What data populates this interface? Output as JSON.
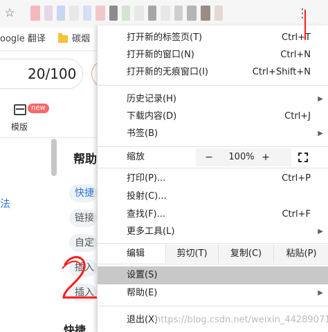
{
  "bookmarks": {
    "google_translate": "oogle 翻译",
    "folder_label": "碳烟"
  },
  "page": {
    "score": "20/100",
    "new_badge": "new",
    "template_label": "模版",
    "left_link": "法",
    "help_heading": "帮助",
    "tags": [
      "快捷",
      "链接",
      "自定",
      "插入",
      "插入"
    ],
    "bottom_heading": "快捷",
    "annotation": "2"
  },
  "menu": {
    "group1": [
      {
        "label": "打开新的标签页(T)",
        "shortcut": "Ctrl+T"
      },
      {
        "label": "打开新的窗口(N)",
        "shortcut": "Ctrl+N"
      },
      {
        "label": "打开新的无痕窗口(I)",
        "shortcut": "Ctrl+Shift+N"
      }
    ],
    "group2": [
      {
        "label": "历史记录(H)",
        "shortcut": "",
        "arrow": "▶"
      },
      {
        "label": "下载内容(D)",
        "shortcut": "Ctrl+J"
      },
      {
        "label": "书签(B)",
        "shortcut": "",
        "arrow": "▶"
      }
    ],
    "zoom": {
      "label": "缩放",
      "minus": "−",
      "value": "100%",
      "plus": "+"
    },
    "group3": [
      {
        "label": "打印(P)...",
        "shortcut": "Ctrl+P"
      },
      {
        "label": "投射(C)..."
      },
      {
        "label": "查找(F)...",
        "shortcut": "Ctrl+F"
      },
      {
        "label": "更多工具(L)",
        "arrow": "▶"
      }
    ],
    "edit": {
      "label": "编辑",
      "cut": "剪切(T)",
      "copy": "复制(C)",
      "paste": "粘贴(P)"
    },
    "group4": [
      {
        "label": "设置(S)"
      },
      {
        "label": "帮助(E)",
        "arrow": "▶"
      }
    ],
    "exit": {
      "label": "退出(X)"
    }
  },
  "watermark": "https://blog.csdn.net/weixin_44289071",
  "colors": {
    "highlight": "#c8c8c8",
    "annotation_red": "#ff1a1a",
    "link_blue": "#2f7ad6",
    "new_badge": "#f46a6a"
  }
}
